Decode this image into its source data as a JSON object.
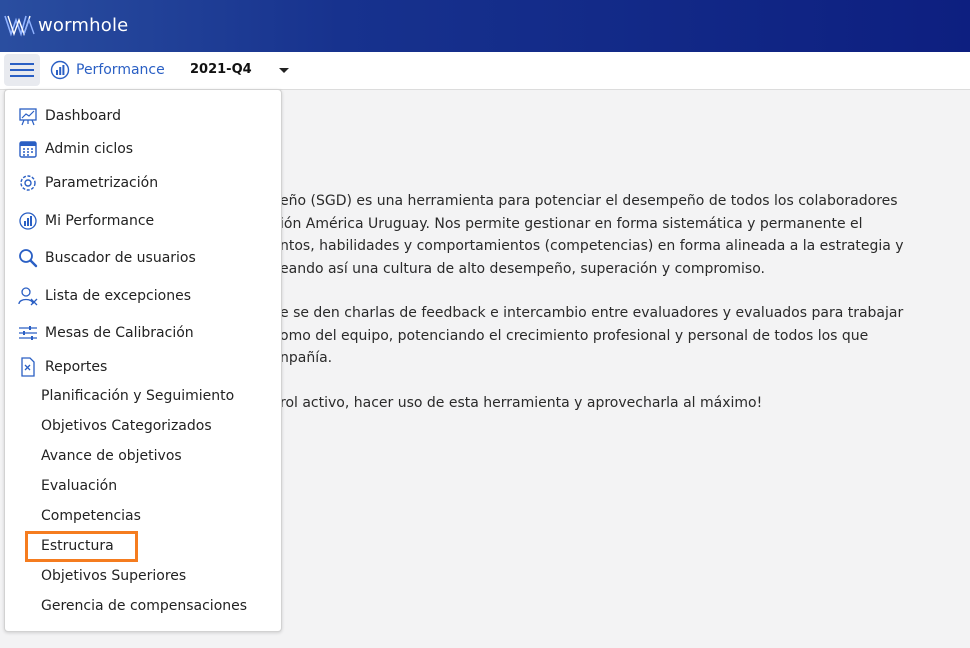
{
  "app": {
    "brand": "wormhole"
  },
  "toolbar": {
    "module_label": "Performance",
    "period_value": "2021-Q4"
  },
  "content": {
    "paragraphs": [
      [
        "eño (SGD) es una herramienta para potenciar el desempeño de todos los colaboradores",
        "ión América Uruguay. Nos permite gestionar en forma sistemática y permanente el",
        "ntos, habilidades y comportamientos (competencias) en forma alineada a la estrategia y",
        "eando así una cultura de alto desempeño, superación y compromiso."
      ],
      [
        "e se den charlas de feedback e intercambio entre evaluadores y evaluados para trabajar",
        "omo del equipo, potenciando el crecimiento profesional y personal de todos los que",
        "npañía."
      ],
      [
        "rol activo, hacer uso de esta herramienta y aprovecharla al máximo!"
      ]
    ]
  },
  "menu": {
    "items": [
      {
        "label": "Dashboard",
        "icon": "dashboard-icon"
      },
      {
        "label": "Admin ciclos",
        "icon": "calendar-icon"
      },
      {
        "label": "Parametrización",
        "icon": "gear-icon"
      },
      {
        "label": "Mi Performance",
        "icon": "performance-gauge-icon"
      },
      {
        "label": "Buscador de usuarios",
        "icon": "search-icon"
      },
      {
        "label": "Lista de excepciones",
        "icon": "user-exception-icon"
      },
      {
        "label": "Mesas de Calibración",
        "icon": "sliders-icon"
      },
      {
        "label": "Reportes",
        "icon": "report-file-icon"
      }
    ],
    "report_subitems": [
      "Planificación y Seguimiento",
      "Objetivos Categorizados",
      "Avance de objetivos",
      "Evaluación",
      "Competencias",
      "Estructura",
      "Objetivos Superiores",
      "Gerencia de compensaciones"
    ],
    "highlighted_item": "Estructura"
  },
  "colors": {
    "accent": "#2a5fc4",
    "header_dark": "#0d1f80",
    "highlight": "#f57c1f"
  }
}
